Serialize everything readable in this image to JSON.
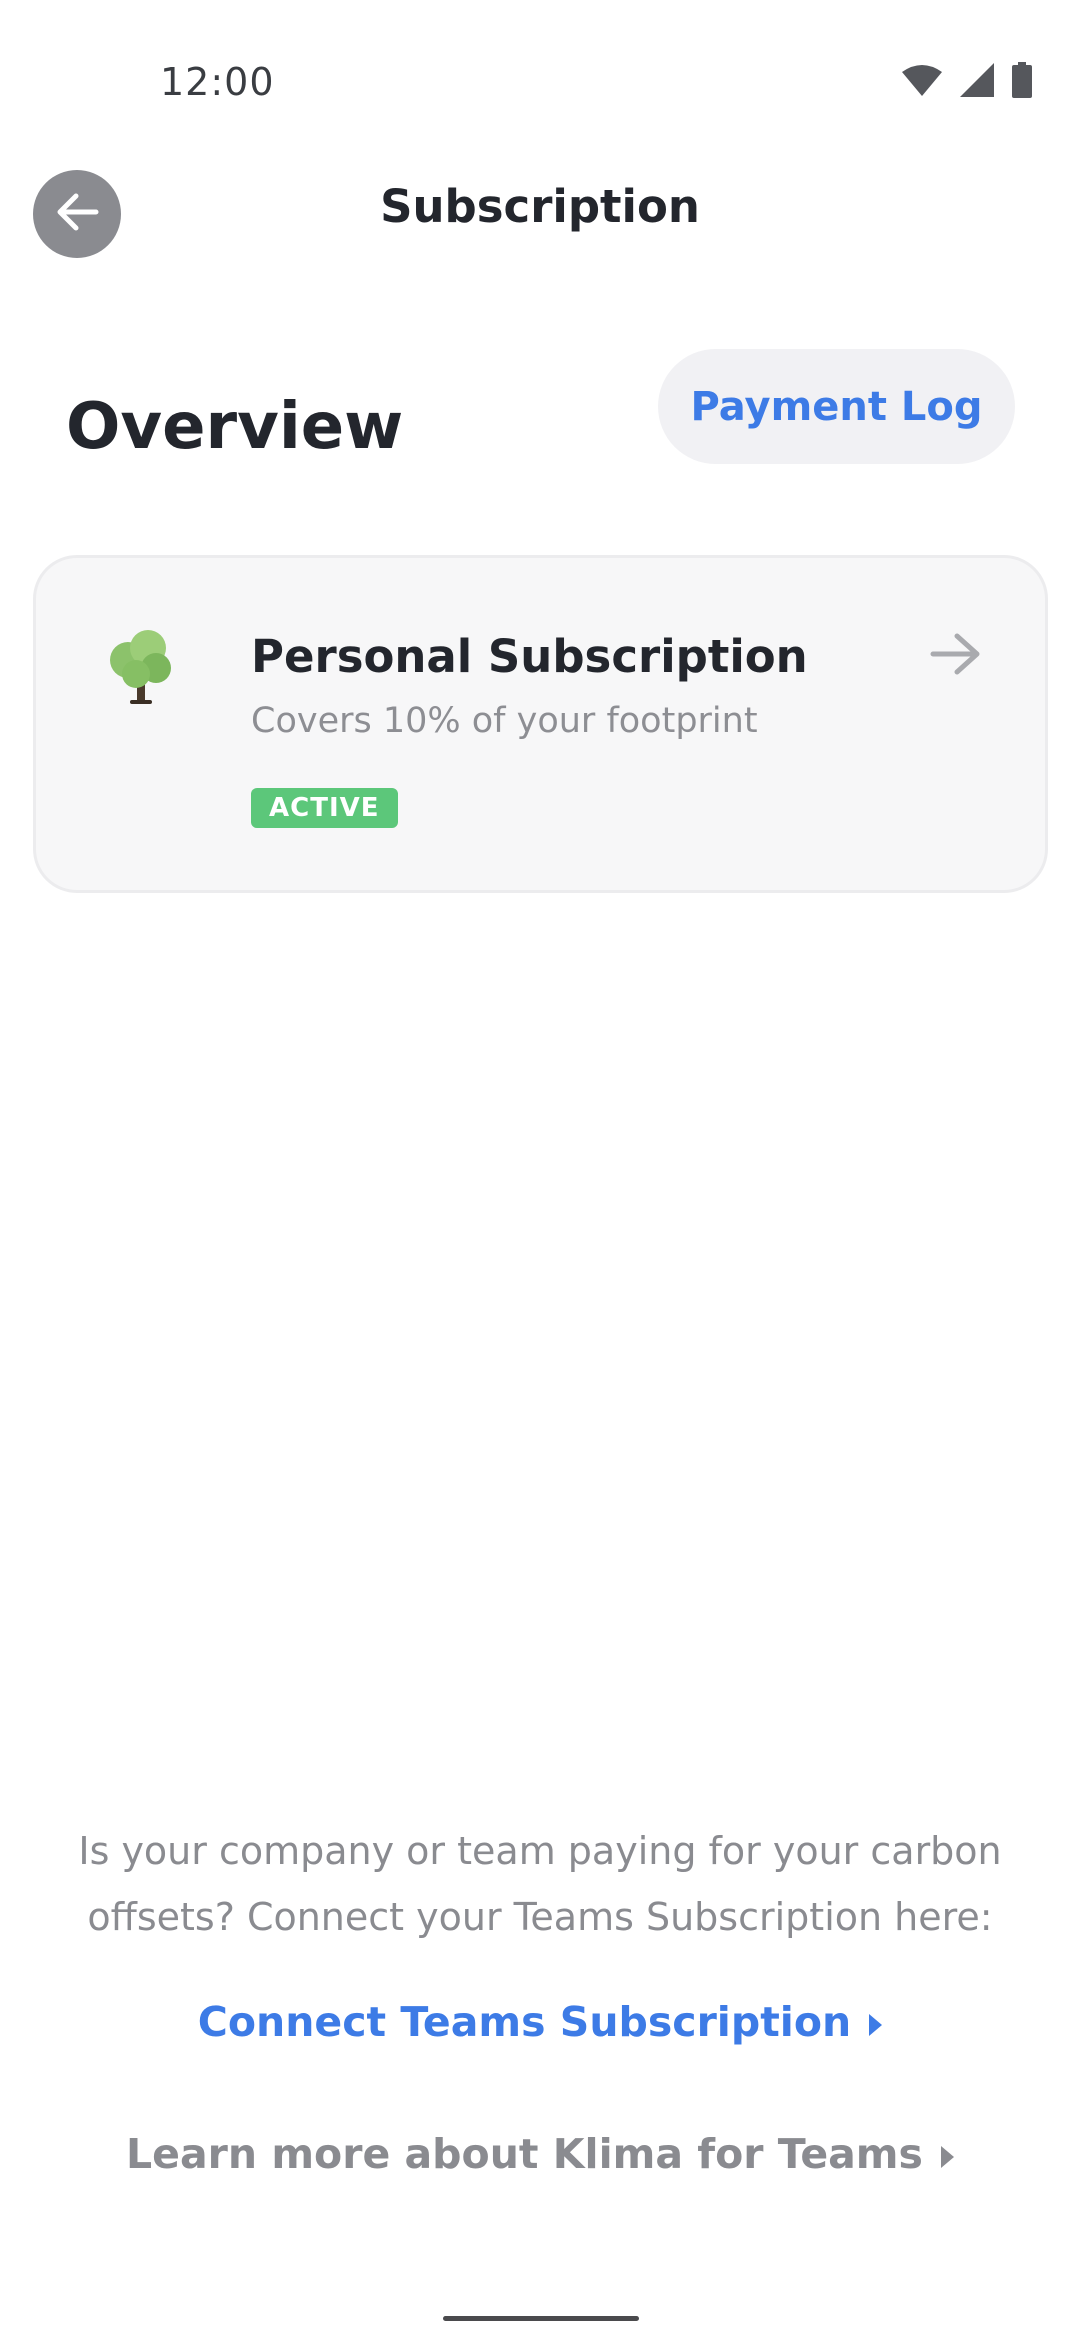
{
  "status_bar": {
    "time": "12:00",
    "icons": [
      "wifi-icon",
      "signal-icon",
      "battery-icon"
    ]
  },
  "header": {
    "back_icon": "arrow-left-icon",
    "title": "Subscription"
  },
  "overview": {
    "title": "Overview",
    "payment_log_label": "Payment Log"
  },
  "subscription_card": {
    "icon": "tree-icon",
    "title": "Personal Subscription",
    "description": "Covers 10% of your footprint",
    "status": "ACTIVE",
    "arrow_icon": "arrow-right-icon"
  },
  "teams": {
    "info": "Is your company or team paying for your carbon offsets? Connect your Teams Subscription here:",
    "connect_label": "Connect Teams Subscription",
    "learn_more_label": "Learn more about Klima for Teams"
  },
  "colors": {
    "accent": "#3d7be6",
    "active_badge": "#5cc77a",
    "muted_text": "#8a8b90"
  }
}
